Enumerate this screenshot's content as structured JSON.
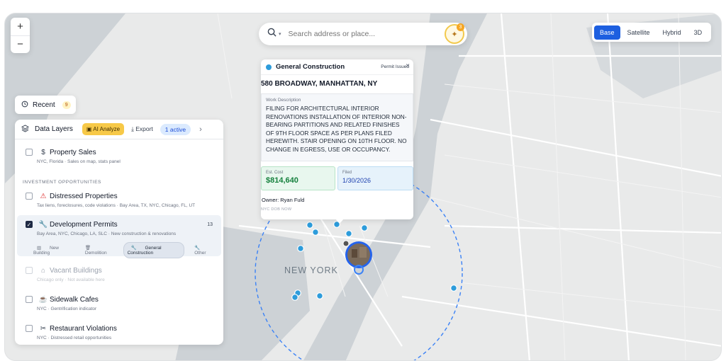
{
  "map": {
    "city_label": "NEW YORK",
    "zoom_in": "+",
    "zoom_out": "−",
    "colors": {
      "marker": "#2d9cdb",
      "radius": "#3b82f6",
      "water": "#c9cfd3",
      "land": "#e9eaea"
    }
  },
  "search": {
    "placeholder": "Search address or place...",
    "ai_badge": "3"
  },
  "map_type": {
    "options": [
      "Base",
      "Satellite",
      "Hybrid",
      "3D"
    ],
    "selected": "Base"
  },
  "recent": {
    "label": "Recent",
    "count": "9"
  },
  "layers_panel": {
    "title": "Data Layers",
    "ai_analyze": "AI Analyze",
    "export": "Export",
    "active": "1 active",
    "section_investment": "INVESTMENT OPPORTUNITIES",
    "items": [
      {
        "label": "Property Sales",
        "sub": "NYC, Florida · Sales on map, stats panel",
        "checked": false
      },
      {
        "label": "Distressed Properties",
        "sub": "Tax liens, foreclosures, code violations · Bay Area, TX, NYC, Chicago, FL, UT",
        "checked": false
      },
      {
        "label": "Development Permits",
        "sub": "Bay Area, NYC, Chicago, LA, SLC · New construction & renovations",
        "checked": true,
        "count": "13",
        "chips": [
          "New Building",
          "Demolition",
          "General Construction",
          "Other"
        ],
        "selected_chip": "General Construction"
      },
      {
        "label": "Vacant Buildings",
        "sub": "Chicago only · Not available here",
        "checked": false,
        "disabled": true
      },
      {
        "label": "Sidewalk Cafes",
        "sub": "NYC · Gentrification indicator",
        "checked": false
      },
      {
        "label": "Restaurant Violations",
        "sub": "NYC · Distressed retail opportunities",
        "checked": false
      }
    ]
  },
  "popup": {
    "type": "General Construction",
    "status": "Permit Issued",
    "address": "580 BROADWAY, MANHATTAN, NY",
    "work_label": "Work Description",
    "work_text": "FILING FOR ARCHITECTURAL INTERIOR RENOVATIONS INSTALLATION OF INTERIOR NON-BEARING PARTITIONS AND RELATED FINISHES OF 9TH FLOOR SPACE AS PER PLANS FILED HEREWITH. STAIR OPENING ON 10TH FLOOR. NO CHANGE IN EGRESS, USE OR OCCUPANCY.",
    "cost_label": "Est. Cost",
    "cost": "$814,640",
    "filed_label": "Filed",
    "filed": "1/30/2026",
    "owner": "Owner: Ryan Fuld",
    "source": "NYC DOB NOW"
  }
}
